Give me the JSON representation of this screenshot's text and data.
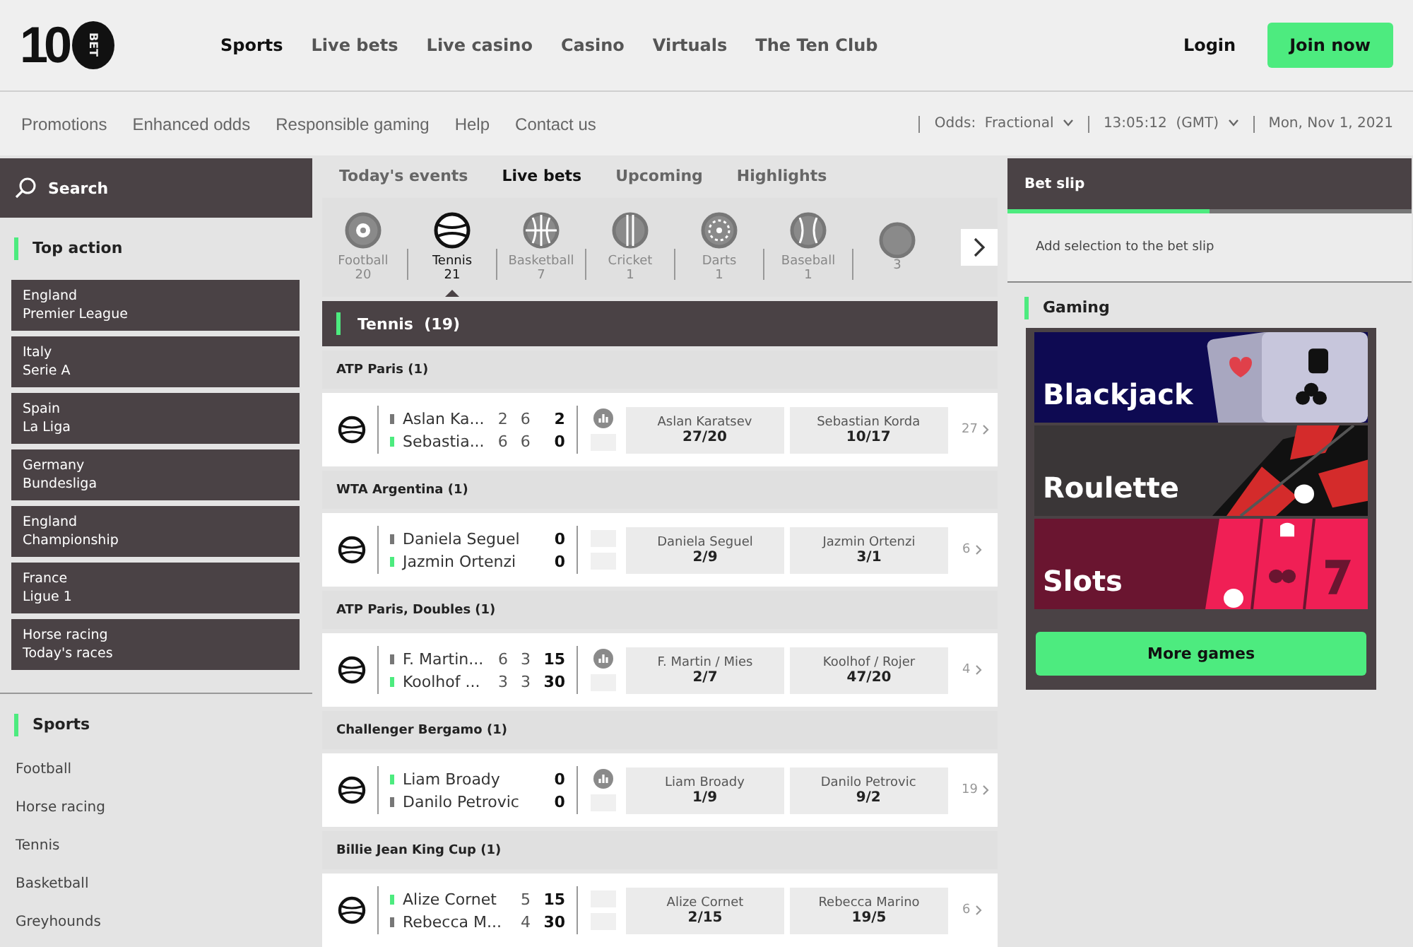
{
  "logo": {
    "mark": "10",
    "text": "BET"
  },
  "main_nav": [
    {
      "label": "Sports",
      "selected": true
    },
    {
      "label": "Live bets",
      "selected": false
    },
    {
      "label": "Live casino",
      "selected": false
    },
    {
      "label": "Casino",
      "selected": false
    },
    {
      "label": "Virtuals",
      "selected": false
    },
    {
      "label": "The Ten Club",
      "selected": false
    }
  ],
  "account": {
    "login": "Login",
    "join": "Join now"
  },
  "sub_nav": [
    "Promotions",
    "Enhanced odds",
    "Responsible gaming",
    "Help",
    "Contact us"
  ],
  "settings": {
    "odds_label": "Odds:",
    "odds_value": "Fractional",
    "time": "13:05:12",
    "timezone": "(GMT)",
    "date": "Mon, Nov 1, 2021"
  },
  "sidebar": {
    "search": "Search",
    "top_action_title": "Top action",
    "top_action": [
      {
        "line1": "England",
        "line2": "Premier League"
      },
      {
        "line1": "Italy",
        "line2": "Serie A"
      },
      {
        "line1": "Spain",
        "line2": "La Liga"
      },
      {
        "line1": "Germany",
        "line2": "Bundesliga"
      },
      {
        "line1": "England",
        "line2": "Championship"
      },
      {
        "line1": "France",
        "line2": "Ligue 1"
      },
      {
        "line1": "Horse racing",
        "line2": "Today's races"
      }
    ],
    "sports_title": "Sports",
    "sports": [
      "Football",
      "Horse racing",
      "Tennis",
      "Basketball",
      "Greyhounds"
    ]
  },
  "event_tabs": [
    {
      "label": "Today's events",
      "selected": false
    },
    {
      "label": "Live bets",
      "selected": true
    },
    {
      "label": "Upcoming",
      "selected": false
    },
    {
      "label": "Highlights",
      "selected": false
    }
  ],
  "sport_carousel": [
    {
      "kind": "football",
      "label": "Football",
      "count": "20",
      "selected": false
    },
    {
      "kind": "tennis",
      "label": "Tennis",
      "count": "21",
      "selected": true
    },
    {
      "kind": "basketball",
      "label": "Basketball",
      "count": "7",
      "selected": false
    },
    {
      "kind": "cricket",
      "label": "Cricket",
      "count": "1",
      "selected": false
    },
    {
      "kind": "darts",
      "label": "Darts",
      "count": "1",
      "selected": false
    },
    {
      "kind": "baseball",
      "label": "Baseball",
      "count": "1",
      "selected": false
    },
    {
      "kind": "other",
      "count": "3",
      "selected": false
    }
  ],
  "section_title": "Tennis",
  "section_count": "(19)",
  "competitions": [
    {
      "name": "ATP Paris (1)",
      "stats": true,
      "players": [
        {
          "name": "Aslan Ka...",
          "serving": false,
          "scores": [
            "2",
            "6",
            "2"
          ]
        },
        {
          "name": "Sebastia...",
          "serving": true,
          "scores": [
            "6",
            "6",
            "0"
          ]
        }
      ],
      "odds": [
        {
          "label": "Aslan Karatsev",
          "price": "27/20"
        },
        {
          "label": "Sebastian Korda",
          "price": "10/17"
        }
      ],
      "markets": "27"
    },
    {
      "name": "WTA Argentina (1)",
      "stats": false,
      "players": [
        {
          "name": "Daniela Seguel",
          "serving": false,
          "scores": [
            "0"
          ]
        },
        {
          "name": "Jazmin Ortenzi",
          "serving": true,
          "scores": [
            "0"
          ]
        }
      ],
      "odds": [
        {
          "label": "Daniela Seguel",
          "price": "2/9"
        },
        {
          "label": "Jazmin Ortenzi",
          "price": "3/1"
        }
      ],
      "markets": "6"
    },
    {
      "name": "ATP Paris, Doubles (1)",
      "stats": true,
      "players": [
        {
          "name": "F. Martin...",
          "serving": false,
          "scores": [
            "6",
            "3",
            "15"
          ]
        },
        {
          "name": "Koolhof ...",
          "serving": true,
          "scores": [
            "3",
            "3",
            "30"
          ]
        }
      ],
      "odds": [
        {
          "label": "F. Martin / Mies",
          "price": "2/7"
        },
        {
          "label": "Koolhof / Rojer",
          "price": "47/20"
        }
      ],
      "markets": "4"
    },
    {
      "name": "Challenger Bergamo (1)",
      "stats": true,
      "players": [
        {
          "name": "Liam Broady",
          "serving": true,
          "scores": [
            "0"
          ]
        },
        {
          "name": "Danilo Petrovic",
          "serving": false,
          "scores": [
            "0"
          ]
        }
      ],
      "odds": [
        {
          "label": "Liam Broady",
          "price": "1/9"
        },
        {
          "label": "Danilo Petrovic",
          "price": "9/2"
        }
      ],
      "markets": "19"
    },
    {
      "name": "Billie Jean King Cup (1)",
      "stats": false,
      "players": [
        {
          "name": "Alize Cornet",
          "serving": true,
          "scores": [
            "5",
            "15"
          ]
        },
        {
          "name": "Rebecca M...",
          "serving": false,
          "scores": [
            "4",
            "30"
          ]
        }
      ],
      "odds": [
        {
          "label": "Alize Cornet",
          "price": "2/15"
        },
        {
          "label": "Rebecca Marino",
          "price": "19/5"
        }
      ],
      "markets": "6"
    }
  ],
  "bet_slip": {
    "title": "Bet slip",
    "message": "Add selection to the bet slip"
  },
  "gaming": {
    "title": "Gaming",
    "games": [
      {
        "kind": "blackjack",
        "name": "Blackjack"
      },
      {
        "kind": "roulette",
        "name": "Roulette"
      },
      {
        "kind": "slots",
        "name": "Slots"
      }
    ],
    "more": "More games"
  }
}
